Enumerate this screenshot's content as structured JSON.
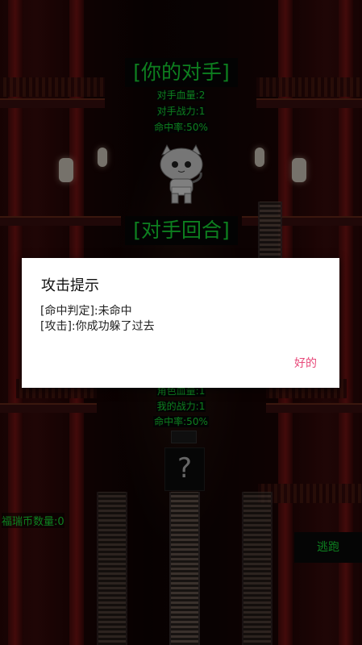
{
  "opponent_panel": {
    "title": "[你的对手]",
    "hp": "对手血量:2",
    "power": "对手战力:1",
    "hit_rate": "命中率:50%"
  },
  "turn_label": "[对手回合]",
  "player_panel": {
    "hp": "角色血量:1",
    "power": "我的战力:1",
    "hit_rate": "命中率:50%"
  },
  "mystery_symbol": "?",
  "coin_count": "福瑞币数量:0",
  "flee_button": "逃跑",
  "dialog": {
    "title": "攻击提示",
    "line1": "[命中判定]:未命中",
    "line2": "[攻击]:你成功躲了过去",
    "ok": "好的"
  },
  "colors": {
    "text_green": "#19e83a",
    "ok_pink": "#e8497a"
  },
  "icons": [
    "opponent-cat-icon",
    "question-mark-icon"
  ]
}
